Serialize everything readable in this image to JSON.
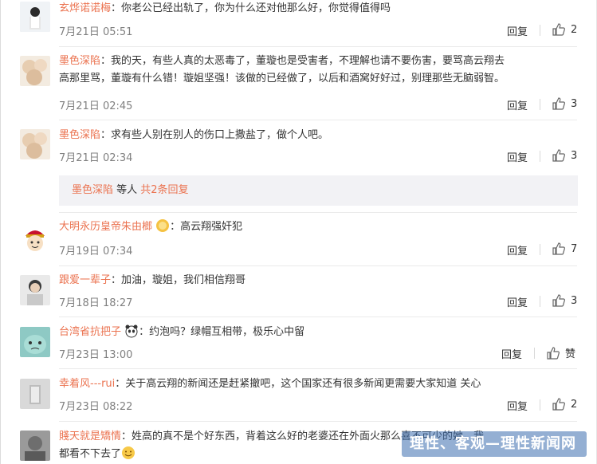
{
  "comments": [
    {
      "user": "玄烨诺诺梅",
      "text": "：你老公已经出轨了，你为什么还对他那么好，你觉得值得吗",
      "time": "7月21日 05:51",
      "likes": "2"
    },
    {
      "user": "墨色深陷",
      "text": "：我的天，有些人真的太恶毒了，董璇也是受害者，不理解也请不要伤害，要骂高云翔去",
      "text2": "高那里骂，董璇有什么错！璇姐坚强！该做的已经做了，以后和酒窝好好过，别理那些无脑弱智。",
      "time": "7月21日 02:45",
      "likes": "3"
    },
    {
      "user": "墨色深陷",
      "text": "：求有些人别在别人的伤口上撒盐了，做个人吧。",
      "time": "7月21日 02:34",
      "likes": "3"
    },
    {
      "user": "大明永历皇帝朱由榔",
      "text": "：高云翔强奸犯",
      "time": "7月19日 07:34",
      "likes": "7"
    },
    {
      "user": "跟爱一辈子",
      "text": "：加油，璇姐，我们相信翔哥",
      "time": "7月18日 18:27",
      "likes": "3"
    },
    {
      "user": "台湾省抗把子",
      "text": "：约泡吗？绿帽互相带，极乐心中留",
      "time": "7月23日 13:00",
      "likes": "赞"
    },
    {
      "user": "幸着风---rui",
      "text": "：关于高云翔的新闻还是赶紧撤吧，这个国家还有很多新闻更需要大家知道 关心",
      "time": "7月23日 08:22",
      "likes": "2"
    },
    {
      "user": "賤天就是矯情",
      "text": "：姓高的真不是个好东西，背着这么好的老婆还在外面火那么喜不可少的她。我",
      "text2": "都看不下去了"
    }
  ],
  "subreply": {
    "user": "墨色深陷",
    "mid": " 等人 ",
    "count": "共2条回复"
  },
  "reply_label": "回复",
  "watermark": "理性、客观—理性新闻网",
  "colors": {
    "username": "#eb7350",
    "time": "#808080",
    "subreply_bg": "#f2f2f5"
  }
}
